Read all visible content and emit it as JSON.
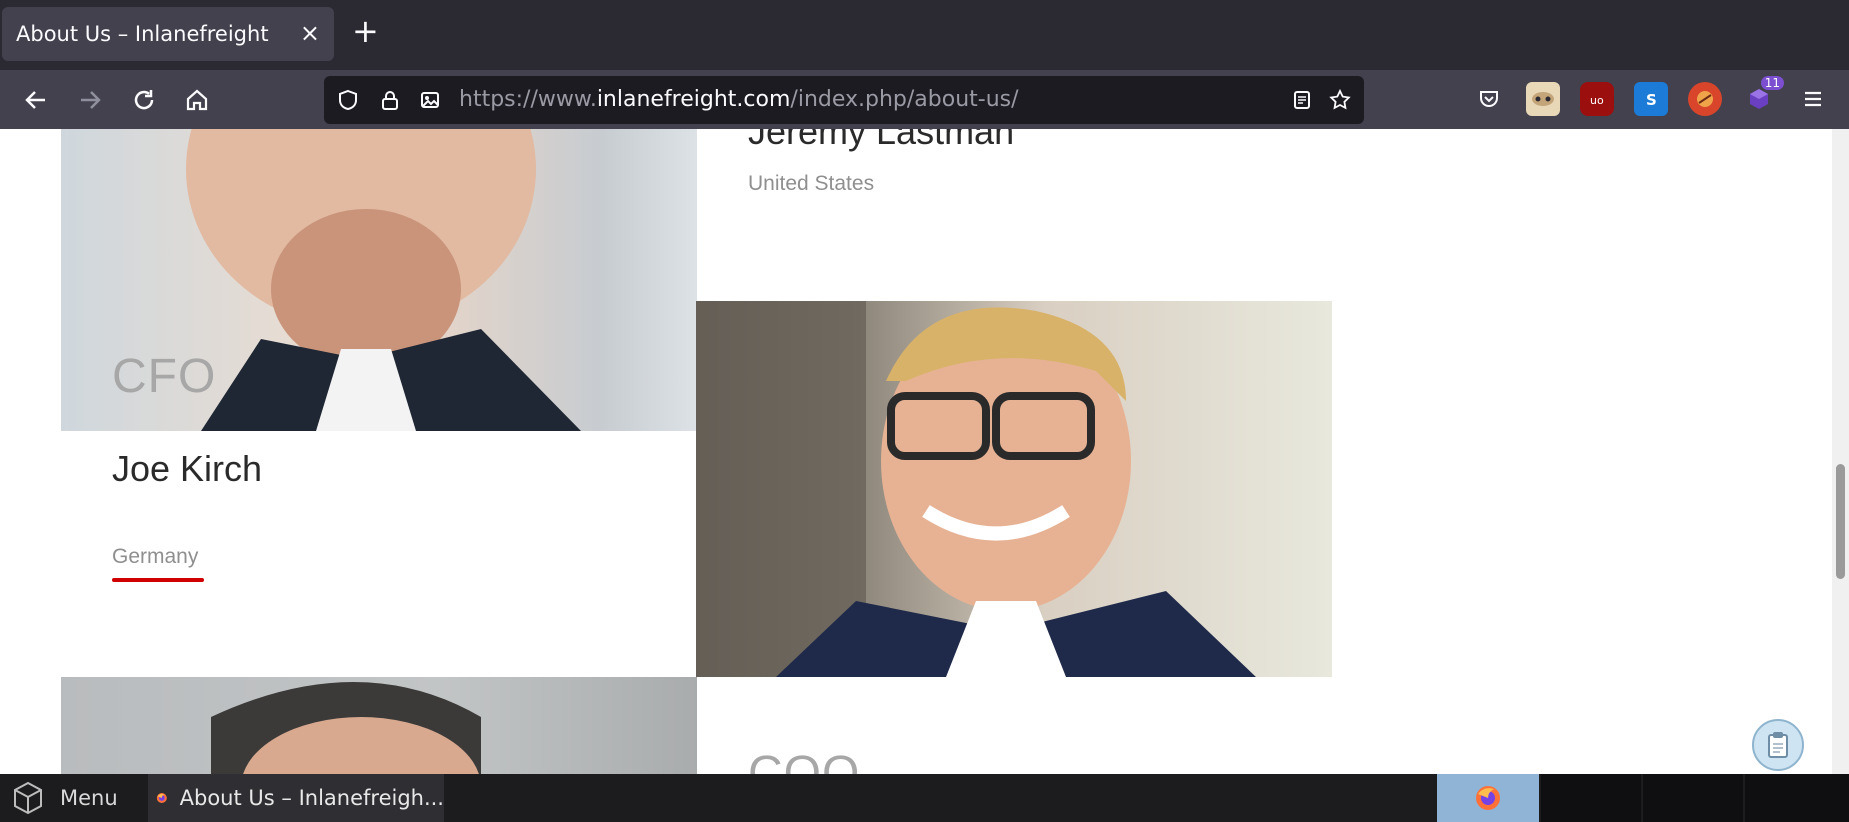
{
  "browser": {
    "tab_title": "About Us – Inlanefreight",
    "tab_close": "×",
    "new_tab": "+",
    "url_prefix": "https://www.",
    "url_domain": "inlanefreight.com",
    "url_path": "/index.php/about-us/",
    "extension_badge": "11"
  },
  "page": {
    "member1": {
      "name": "Jeremy Lastman",
      "country": "United States"
    },
    "member2": {
      "role": "CFO",
      "name": "Joe Kirch",
      "country": "Germany"
    },
    "member3": {
      "role": "COO"
    }
  },
  "taskbar": {
    "menu_label": "Menu",
    "app_label": "About Us – Inlanefreigh..."
  },
  "colors": {
    "accent_underline": "#d10000",
    "chrome_bg": "#2b2a33"
  }
}
